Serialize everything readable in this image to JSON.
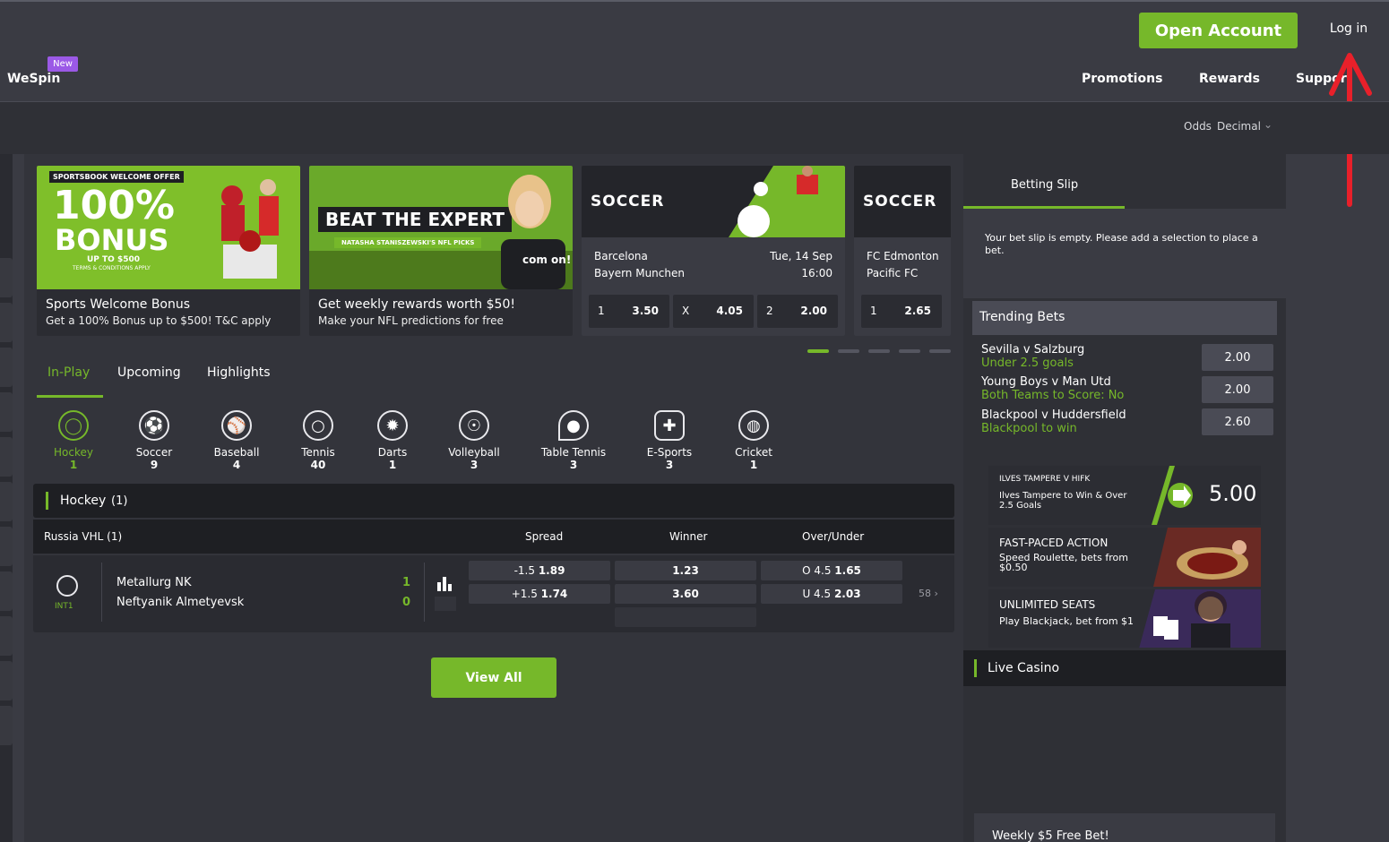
{
  "header": {
    "brand": "WeSpin",
    "new_badge": "New",
    "open_account": "Open Account",
    "login": "Log in",
    "nav": [
      "Promotions",
      "Rewards",
      "Support"
    ]
  },
  "odds_format": {
    "label": "Odds",
    "value": "Decimal"
  },
  "promos": [
    {
      "top_tag": "SPORTSBOOK WELCOME OFFER",
      "big": "100%",
      "big2": "BONUS",
      "small": "UP TO $500",
      "tiny": "TERMS & CONDITIONS APPLY",
      "caption": "Sports Welcome Bonus",
      "sub": "Get a 100% Bonus up to $500! T&C apply"
    },
    {
      "headline": "BEAT THE EXPERT",
      "strap": "NATASHA STANISZEWSKI'S NFL PICKS",
      "brand_mark": "com on!",
      "caption": "Get weekly rewards worth $50!",
      "sub": "Make your NFL predictions for free"
    }
  ],
  "soccer_cards": [
    {
      "title": "SOCCER",
      "home": "Barcelona",
      "away": "Bayern Munchen",
      "date": "Tue, 14 Sep",
      "time": "16:00",
      "odds": [
        {
          "label": "1",
          "value": "3.50"
        },
        {
          "label": "X",
          "value": "4.05"
        },
        {
          "label": "2",
          "value": "2.00"
        }
      ]
    },
    {
      "title": "SOCCER",
      "home": "FC Edmonton",
      "away": "Pacific FC",
      "odds": [
        {
          "label": "1",
          "value": "2.65"
        }
      ]
    }
  ],
  "tabs": [
    "In-Play",
    "Upcoming",
    "Highlights"
  ],
  "sports": [
    {
      "name": "Hockey",
      "count": "1",
      "icon": "hockey-puck-icon"
    },
    {
      "name": "Soccer",
      "count": "9",
      "icon": "soccer-ball-icon"
    },
    {
      "name": "Baseball",
      "count": "4",
      "icon": "baseball-icon"
    },
    {
      "name": "Tennis",
      "count": "40",
      "icon": "tennis-ball-icon"
    },
    {
      "name": "Darts",
      "count": "1",
      "icon": "dartboard-icon"
    },
    {
      "name": "Volleyball",
      "count": "3",
      "icon": "volleyball-icon"
    },
    {
      "name": "Table Tennis",
      "count": "3",
      "icon": "table-tennis-icon"
    },
    {
      "name": "E-Sports",
      "count": "3",
      "icon": "gamepad-icon"
    },
    {
      "name": "Cricket",
      "count": "1",
      "icon": "cricket-ball-icon"
    }
  ],
  "section": {
    "title": "Hockey",
    "count": "(1)"
  },
  "league": {
    "name": "Russia VHL (1)",
    "cols": [
      "Spread",
      "Winner",
      "Over/Under"
    ]
  },
  "match": {
    "period": "INT1",
    "home": "Metallurg NK",
    "away": "Neftyanik Almetyevsk",
    "home_score": "1",
    "away_score": "0",
    "spread": [
      {
        "line": "-1.5",
        "odd": "1.89"
      },
      {
        "line": "+1.5",
        "odd": "1.74"
      }
    ],
    "winner": [
      "1.23",
      "3.60"
    ],
    "ou": [
      {
        "line": "O 4.5",
        "odd": "1.65"
      },
      {
        "line": "U 4.5",
        "odd": "2.03"
      }
    ],
    "more": "58"
  },
  "view_all": "View All",
  "slip": {
    "tab": "Betting Slip",
    "empty": "Your bet slip is empty. Please add a selection to place a bet."
  },
  "trending": {
    "title": "Trending Bets",
    "items": [
      {
        "match": "Sevilla v Salzburg",
        "sel": "Under 2.5 goals",
        "odd": "2.00"
      },
      {
        "match": "Young Boys v Man Utd",
        "sel": "Both Teams to Score: No",
        "odd": "2.00"
      },
      {
        "match": "Blackpool v Huddersfield",
        "sel": "Blackpool to win",
        "odd": "2.60"
      }
    ]
  },
  "right_promos": [
    {
      "tag": "ILVES TAMPERE V HIFK",
      "text": "Ilves Tampere to Win & Over 2.5 Goals",
      "odd": "5.00"
    },
    {
      "title": "FAST-PACED ACTION",
      "text": "Speed Roulette, bets from $0.50"
    },
    {
      "title": "UNLIMITED SEATS",
      "text": "Play Blackjack, bet from $1"
    }
  ],
  "live_casino": "Live Casino",
  "weekly": "Weekly $5 Free Bet!",
  "colors": {
    "accent": "#76b82a",
    "bg": "#3a3b43",
    "dark": "#1e1f23",
    "annotation": "#e8202a"
  }
}
